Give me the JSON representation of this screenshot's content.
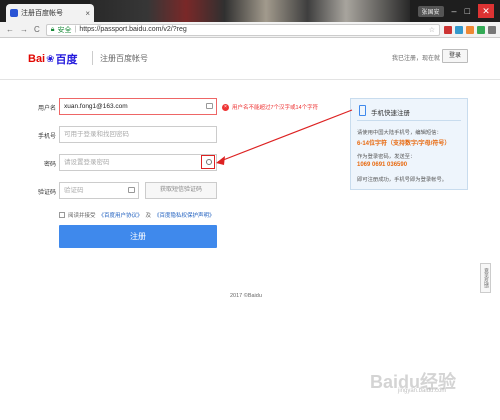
{
  "browser": {
    "tab_title": "注册百度帐号",
    "tab_close": "×",
    "user_badge": "张国安",
    "window_minimize": "–",
    "window_maximize": "□",
    "window_close": "✕",
    "nav_back": "←",
    "nav_forward": "→",
    "nav_reload": "C",
    "secure_label": "安全",
    "separator": "|",
    "url": "https://passport.baidu.com/v2/?reg",
    "star": "☆"
  },
  "header": {
    "logo_text_left": "Bai",
    "logo_paw": "❀",
    "logo_text_right": "百度",
    "title": "注册百度帐号",
    "login_hint": "我已注册，现在就",
    "login_button": "登录"
  },
  "form": {
    "username": {
      "label": "用户名",
      "value": "xuan.fong1@163.com",
      "error": "用户名不能超过7个汉字或14个字符",
      "error_icon": "×"
    },
    "phone": {
      "label": "手机号",
      "placeholder": "可用于登录和找回密码"
    },
    "password": {
      "label": "密码",
      "placeholder": "请设置登录密码"
    },
    "verify": {
      "label": "验证码",
      "placeholder": "验证码",
      "button": "获取短信验证码"
    },
    "agree": {
      "text": "阅读并接受",
      "link1": "《百度用户协议》",
      "and": "及",
      "link2": "《百度隐私权保护声明》"
    },
    "register_button": "注册"
  },
  "panel": {
    "title": "手机快速注册",
    "line1": "请使用中国大陆手机号，编辑短信：",
    "code": "6-14位字符（支持数字/字母/符号）",
    "line2": "作为登录密码，发送至：",
    "number": "1069 0691 036590",
    "line3": "即可注册成功，手机号即为登录帐号。"
  },
  "footer": {
    "text": "2017 ©Baidu"
  },
  "side_tab": {
    "label": "意见反馈"
  },
  "watermark": {
    "text": "Baidu经验",
    "sub": "jingyan.baidu.com"
  },
  "colors": {
    "accent": "#3f89ec",
    "error": "#e33333",
    "logo_red": "#e10601",
    "logo_blue": "#2319dc",
    "panel_highlight": "#e86a10"
  }
}
